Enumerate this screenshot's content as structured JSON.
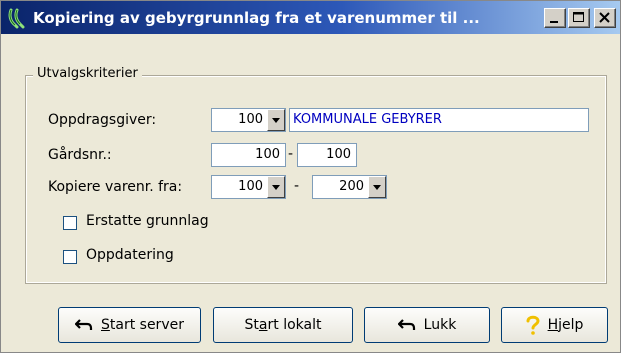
{
  "window": {
    "title": "Kopiering av gebyrgrunnlag fra et varenummer til ...",
    "icon": "app-icon"
  },
  "group": {
    "legend": "Utvalgskriterier"
  },
  "form": {
    "oppdragsgiver_label": "Oppdragsgiver:",
    "oppdragsgiver_value": "100",
    "oppdragsgiver_name": "KOMMUNALE GEBYRER",
    "gardsnr_label": "Gårdsnr.:",
    "gardsnr_from": "100",
    "gardsnr_sep": "-",
    "gardsnr_to": "100",
    "varenr_label": "Kopiere varenr. fra:",
    "varenr_from": "100",
    "varenr_sep": "-",
    "varenr_to": "200",
    "erstatte_label": "Erstatte grunnlag",
    "erstatte_checked": false,
    "oppdatering_label": "Oppdatering",
    "oppdatering_checked": false
  },
  "buttons": {
    "start_server": {
      "mnemonic": "S",
      "rest": "tart server",
      "icon": "undo-arrow-icon"
    },
    "start_lokalt": {
      "pre": "St",
      "mnemonic": "a",
      "rest": "rt lokalt"
    },
    "lukk": {
      "label": "Lukk",
      "icon": "undo-arrow-icon"
    },
    "hjelp": {
      "mnemonic": "H",
      "rest": "jelp",
      "icon": "question-mark-icon"
    }
  },
  "colors": {
    "title_start": "#0a246a",
    "title_end": "#a6caf0",
    "text_blue": "#0000c0",
    "help_yellow": "#f0c000"
  }
}
